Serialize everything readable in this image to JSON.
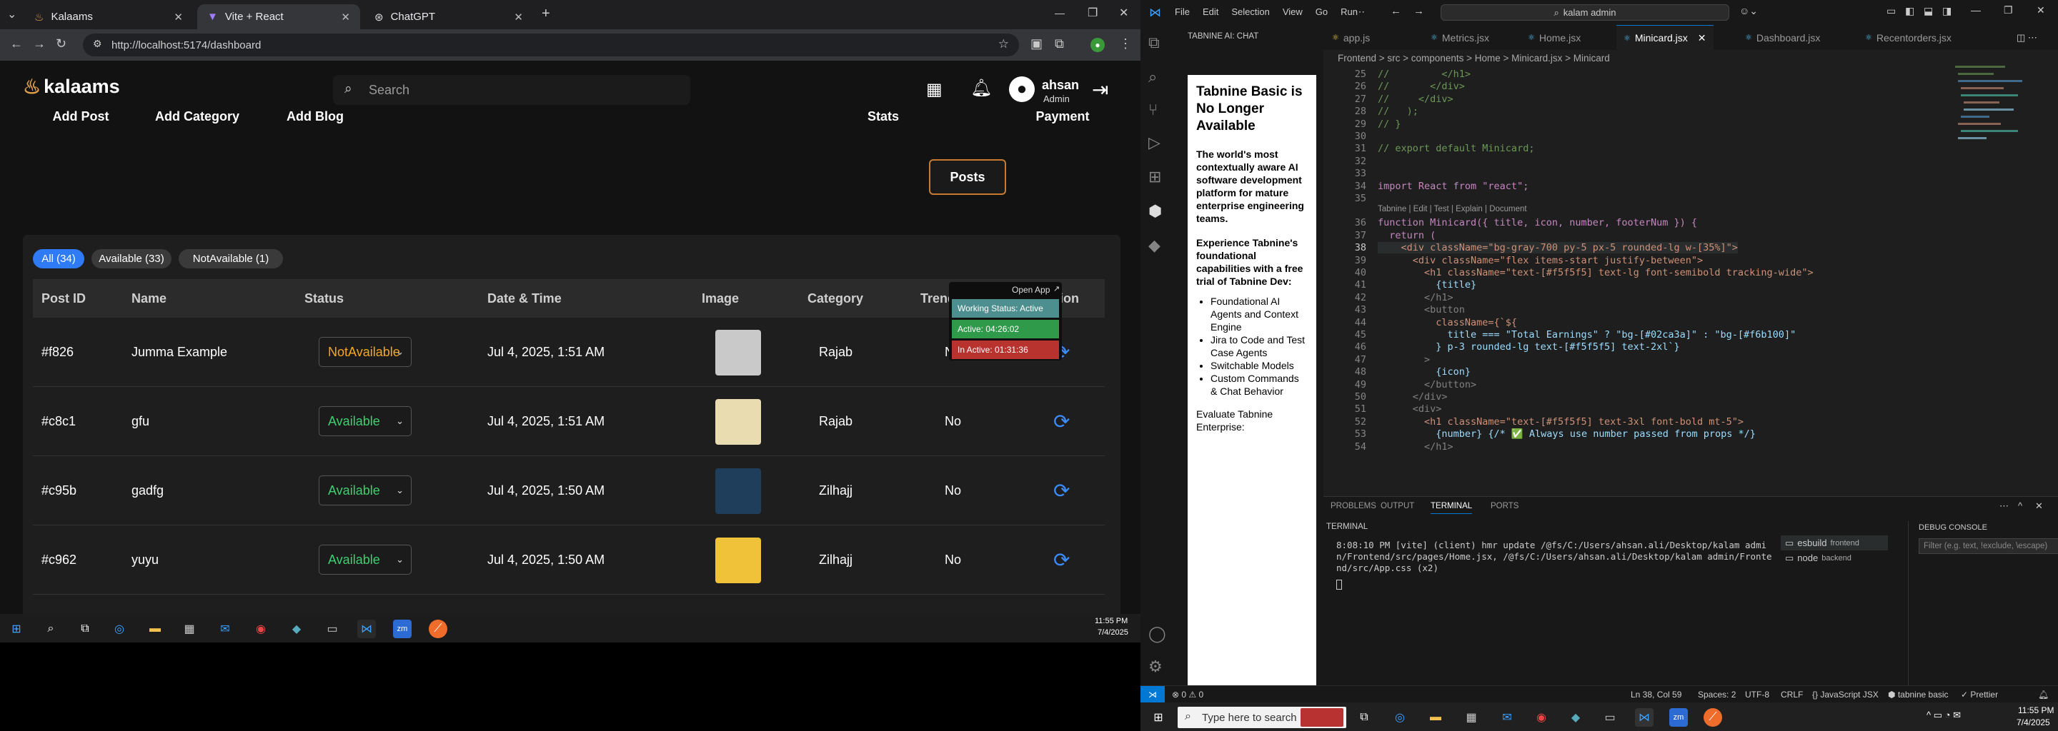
{
  "browser": {
    "tabs": [
      {
        "label": "Kalaams",
        "icon": "kalaams-icon"
      },
      {
        "label": "Vite + React",
        "icon": "vite-icon"
      },
      {
        "label": "ChatGPT",
        "icon": "chatgpt-icon"
      }
    ],
    "url": "http://localhost:5174/dashboard"
  },
  "app": {
    "logo": "kalaams",
    "search_placeholder": "Search",
    "user": {
      "name": "ahsan",
      "role": "Admin"
    },
    "left_buttons": [
      "Add Post",
      "Add Category",
      "Add Blog"
    ],
    "right_buttons": [
      "Stats",
      "Posts",
      "Payment"
    ],
    "active_right_button": "Posts",
    "filters": [
      "All (34)",
      "Available (33)",
      "NotAvailable (1)"
    ],
    "columns": [
      "Post ID",
      "Name",
      "Status",
      "Date & Time",
      "Image",
      "Category",
      "Trending",
      "Action"
    ],
    "rows": [
      {
        "id": "#f826",
        "name": "Jumma Example",
        "status": "NotAvailable",
        "datetime": "Jul 4, 2025, 1:51 AM",
        "category": "Rajab",
        "trending": "No",
        "status_color": "#f5a623",
        "thumb": "#c9c9c9"
      },
      {
        "id": "#c8c1",
        "name": "gfu",
        "status": "Available",
        "datetime": "Jul 4, 2025, 1:51 AM",
        "category": "Rajab",
        "trending": "No",
        "status_color": "#3cd070",
        "thumb": "#e8dcb0"
      },
      {
        "id": "#c95b",
        "name": "gadfg",
        "status": "Available",
        "datetime": "Jul 4, 2025, 1:50 AM",
        "category": "Zilhajj",
        "trending": "No",
        "status_color": "#3cd070",
        "thumb": "#1f3e5c"
      },
      {
        "id": "#c962",
        "name": "yuyu",
        "status": "Available",
        "datetime": "Jul 4, 2025, 1:50 AM",
        "category": "Zilhajj",
        "trending": "No",
        "status_color": "#3cd070",
        "thumb": "#f0c23a"
      }
    ],
    "popup": {
      "open_app": "Open App",
      "working_status": "Working Status: Active",
      "active": "Active: 04:26:02",
      "inactive": "In Active: 01:31:36"
    }
  },
  "taskbar_left": {
    "time": "11:55 PM",
    "date": "7/4/2025"
  },
  "vscode": {
    "menu": [
      "File",
      "Edit",
      "Selection",
      "View",
      "Go",
      "Run"
    ],
    "search": "kalam admin",
    "chat_title": "TABNINE AI: CHAT",
    "chat_heading": "Tabnine Basic is No Longer Available",
    "chat_p1": "The world's most contextually aware AI software development platform for mature enterprise engineering teams.",
    "chat_p2": "Experience Tabnine's foundational capabilities with a free trial of Tabnine Dev:",
    "chat_list": [
      "Foundational AI Agents and Context Engine",
      "Jira to Code and Test Case Agents",
      "Switchable Models",
      "Custom Commands & Chat Behavior"
    ],
    "chat_p3": "Evaluate Tabnine Enterprise:",
    "editor_tabs": [
      "app.js",
      "Metrics.jsx",
      "Home.jsx",
      "Minicard.jsx",
      "Dashboard.jsx",
      "Recentorders.jsx"
    ],
    "active_tab": "Minicard.jsx",
    "breadcrumb": "Frontend > src > components > Home > Minicard.jsx > Minicard",
    "codelens": "Tabnine | Edit | Test | Explain | Document",
    "lines": [
      {
        "n": "25",
        "t": "//         </h1>"
      },
      {
        "n": "26",
        "t": "//       </div>"
      },
      {
        "n": "27",
        "t": "//     </div>"
      },
      {
        "n": "28",
        "t": "//   );"
      },
      {
        "n": "29",
        "t": "// }"
      },
      {
        "n": "30",
        "t": ""
      },
      {
        "n": "31",
        "t": "// export default Minicard;"
      },
      {
        "n": "32",
        "t": ""
      },
      {
        "n": "33",
        "t": ""
      },
      {
        "n": "34",
        "t": "import React from \"react\";"
      },
      {
        "n": "35",
        "t": ""
      },
      {
        "n": "36",
        "t": "function Minicard({ title, icon, number, footerNum }) {"
      },
      {
        "n": "37",
        "t": "  return ("
      },
      {
        "n": "38",
        "t": "    <div className=\"bg-gray-700 py-5 px-5 rounded-lg w-[35%]\">"
      },
      {
        "n": "39",
        "t": "      <div className=\"flex items-start justify-between\">"
      },
      {
        "n": "40",
        "t": "        <h1 className=\"text-[#f5f5f5] text-lg font-semibold tracking-wide\">"
      },
      {
        "n": "41",
        "t": "          {title}"
      },
      {
        "n": "42",
        "t": "        </h1>"
      },
      {
        "n": "43",
        "t": "        <button"
      },
      {
        "n": "44",
        "t": "          className={`${"
      },
      {
        "n": "45",
        "t": "            title === \"Total Earnings\" ? \"bg-[#02ca3a]\" : \"bg-[#f6b100]\""
      },
      {
        "n": "46",
        "t": "          } p-3 rounded-lg text-[#f5f5f5] text-2xl`}"
      },
      {
        "n": "47",
        "t": "        >"
      },
      {
        "n": "48",
        "t": "          {icon}"
      },
      {
        "n": "49",
        "t": "        </button>"
      },
      {
        "n": "50",
        "t": "      </div>"
      },
      {
        "n": "51",
        "t": "      <div>"
      },
      {
        "n": "52",
        "t": "        <h1 className=\"text-[#f5f5f5] text-3xl font-bold mt-5\">"
      },
      {
        "n": "53",
        "t": "          {number} {/* ✅ Always use number passed from props */}"
      },
      {
        "n": "54",
        "t": "        </h1>"
      }
    ],
    "panel_tabs": [
      "PROBLEMS",
      "OUTPUT",
      "TERMINAL",
      "PORTS"
    ],
    "terminal_label": "TERMINAL",
    "terminal_text": "8:08:10 PM [vite] (client) hmr update /@fs/C:/Users/ahsan.ali/Desktop/kalam admin/Frontend/src/pages/Home.jsx, /@fs/C:/Users/ahsan.ali/Desktop/kalam admin/Frontend/src/App.css (x2)",
    "terminals": [
      {
        "name": "esbuild",
        "tag": "frontend"
      },
      {
        "name": "node",
        "tag": "backend"
      }
    ],
    "debug_label": "DEBUG CONSOLE",
    "debug_filter": "Filter (e.g. text, !exclude, \\escape)",
    "status": {
      "errors": "0",
      "warnings": "0",
      "position": "Ln 38, Col 59",
      "spaces": "Spaces: 2",
      "encoding": "UTF-8",
      "eol": "CRLF",
      "lang": "JavaScript JSX",
      "tabnine": "tabnine basic",
      "prettier": "Prettier"
    }
  },
  "taskbar_right": {
    "search_placeholder": "Type here to search",
    "time": "11:55 PM",
    "date": "7/4/2025"
  }
}
